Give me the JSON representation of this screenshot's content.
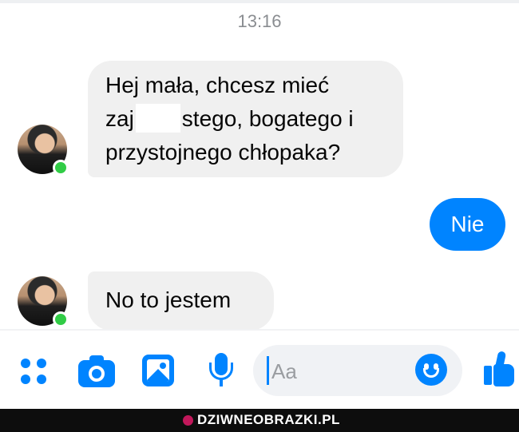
{
  "chat": {
    "timestamp": "13:16",
    "messages": [
      {
        "direction": "incoming",
        "lines": [
          "Hej mała, chcesz mieć",
          "zaj",
          "stego, bogatego i",
          "przystojnego chłopaka?"
        ]
      },
      {
        "direction": "outgoing",
        "text": "Nie"
      },
      {
        "direction": "incoming",
        "text": "No to jestem"
      }
    ]
  },
  "composer": {
    "placeholder": "Aa",
    "icons": [
      "apps-grid-icon",
      "camera-icon",
      "gallery-icon",
      "microphone-icon",
      "emoji-icon",
      "thumbs-up-icon"
    ]
  },
  "watermark": {
    "text": "DZIWNEOBRAZKI.PL"
  },
  "colors": {
    "accent": "#0084ff",
    "incoming_bubble": "#f0f0f0",
    "online_dot": "#31cc46",
    "timestamp": "#8a8d91"
  }
}
